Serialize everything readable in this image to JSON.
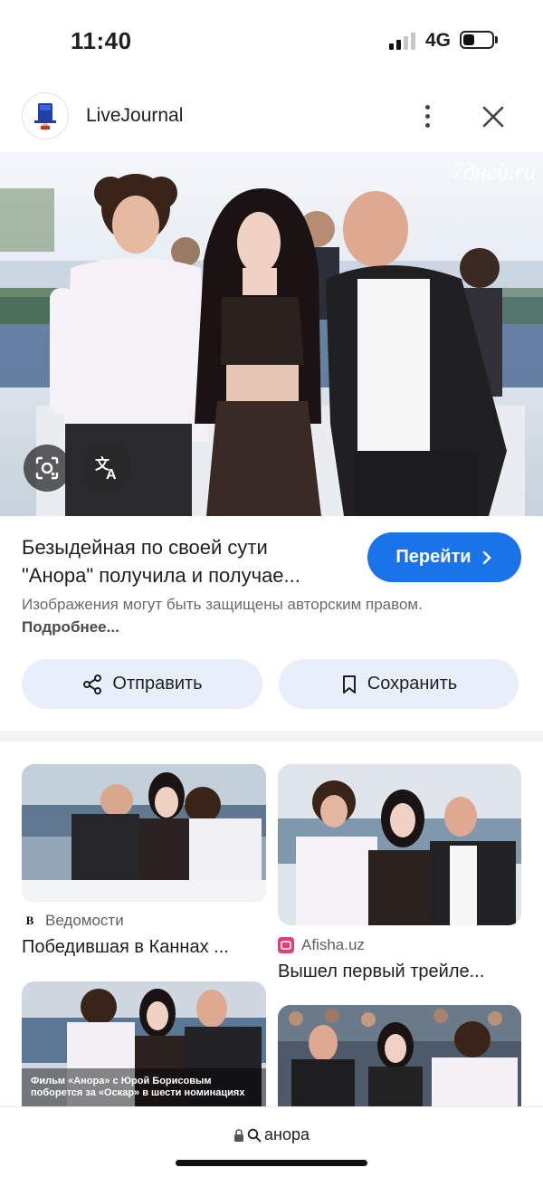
{
  "status_bar": {
    "time": "11:40",
    "network": "4G"
  },
  "source": {
    "site_name": "LiveJournal"
  },
  "hero": {
    "watermark": "7дней.ru"
  },
  "result": {
    "title_line1": "Безыдейная по своей сути",
    "title_line2": "\"Анора\" получила и получае...",
    "visit_label": "Перейти",
    "copyright_text": "Изображения могут быть защищены авторским правом.",
    "more_link": "Подробнее...",
    "share_label": "Отправить",
    "save_label": "Сохранить"
  },
  "related": [
    {
      "source": "Ведомости",
      "title": "Победившая в Каннах ...",
      "favicon": "B"
    },
    {
      "source": "Afisha.uz",
      "title": "Вышел первый трейле...",
      "favicon": ""
    },
    {
      "caption": "Фильм «Анора» с Юрой Борисовым поборется за «Оскар» в шести номинациях"
    },
    {}
  ],
  "bottom_bar": {
    "url_text": "анора"
  },
  "colors": {
    "accent": "#1a73e8",
    "tonal_button": "#e8effa"
  }
}
